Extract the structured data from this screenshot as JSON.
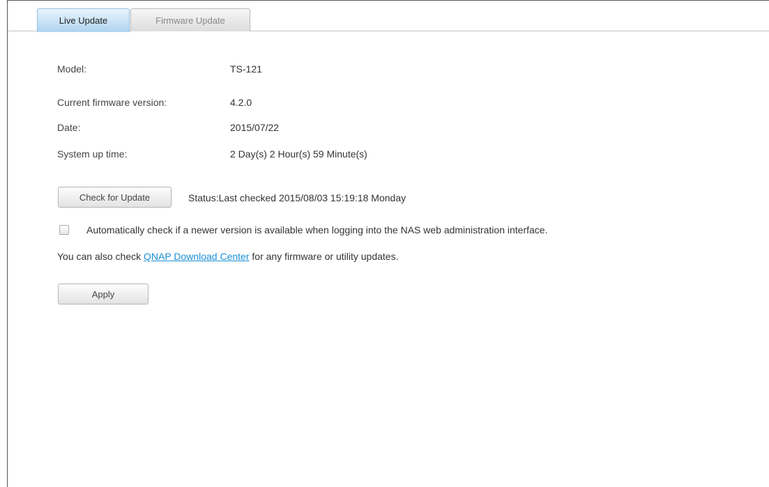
{
  "tabs": [
    {
      "label": "Live Update",
      "active": true
    },
    {
      "label": "Firmware Update",
      "active": false
    }
  ],
  "info": {
    "model_label": "Model:",
    "model_value": "TS-121",
    "firmware_label": "Current firmware version:",
    "firmware_value": "4.2.0",
    "date_label": "Date:",
    "date_value": "2015/07/22",
    "uptime_label": "System up time:",
    "uptime_value": "2 Day(s) 2 Hour(s) 59 Minute(s)"
  },
  "check": {
    "button_label": "Check for Update",
    "status_text": "Status:Last checked 2015/08/03 15:19:18 Monday"
  },
  "auto_check": {
    "checked": false,
    "label": "Automatically check if a newer version is available when logging into the NAS web administration interface."
  },
  "download": {
    "prefix": "You can also check ",
    "link_text": "QNAP Download Center",
    "suffix": " for any firmware or utility updates."
  },
  "apply_label": "Apply",
  "colors": {
    "active_tab": "#aed4f0",
    "link": "#1a8fd6"
  }
}
